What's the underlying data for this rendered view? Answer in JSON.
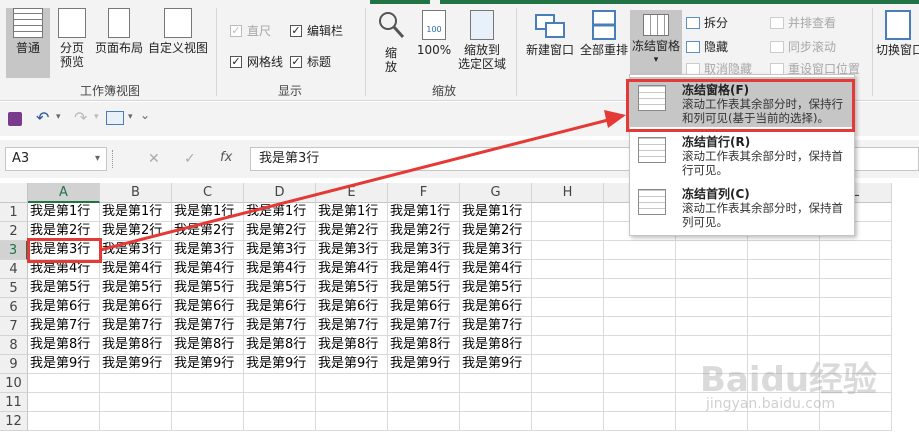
{
  "ribbon": {
    "workbook_views": {
      "normal": "普通",
      "page_break_line1": "分页",
      "page_break_line2": "预览",
      "page_layout": "页面布局",
      "custom_view": "自定义视图",
      "group_label": "工作簿视图"
    },
    "show": {
      "ruler": "直尺",
      "formula_bar": "编辑栏",
      "gridlines": "网格线",
      "headings": "标题",
      "group_label": "显示"
    },
    "zoom": {
      "zoom_line1": "缩",
      "zoom_line2": "放",
      "hundred": "100%",
      "icon_value": "100",
      "zoom_selection_line1": "缩放到",
      "zoom_selection_line2": "选定区域",
      "group_label": "缩放"
    },
    "window": {
      "new_window": "新建窗口",
      "arrange_all": "全部重排",
      "freeze_panes": "冻结窗格",
      "split": "拆分",
      "hide": "隐藏",
      "unhide": "取消隐藏",
      "view_side_by_side": "并排查看",
      "sync_scroll": "同步滚动",
      "reset_position": "重设窗口位置",
      "switch_windows": "切换窗口"
    }
  },
  "formula_bar": {
    "name_box": "A3",
    "fx": "fx",
    "content": "我是第3行",
    "cancel": "✕",
    "confirm": "✓"
  },
  "columns": [
    "A",
    "B",
    "C",
    "D",
    "E",
    "F",
    "G",
    "H",
    "I",
    "J",
    "K",
    "L"
  ],
  "rows": [
    "1",
    "2",
    "3",
    "4",
    "5",
    "6",
    "7",
    "8",
    "9",
    "10",
    "11",
    "12"
  ],
  "cells": [
    "我是第1行",
    "我是第2行",
    "我是第3行",
    "我是第4行",
    "我是第5行",
    "我是第6行",
    "我是第7行",
    "我是第8行",
    "我是第9行"
  ],
  "freeze_menu": {
    "items": [
      {
        "title": "冻结窗格(F)",
        "desc": "滚动工作表其余部分时，保持行和列可见(基于当前的选择)。"
      },
      {
        "title": "冻结首行(R)",
        "desc": "滚动工作表其余部分时，保持首行可见。"
      },
      {
        "title": "冻结首列(C)",
        "desc": "滚动工作表其余部分时，保持首列可见。"
      }
    ]
  },
  "watermark": {
    "line1": "Baidu经验",
    "line2": "jingyan.baidu.com"
  },
  "colors": {
    "excel_green": "#217346",
    "highlight_red": "#e53935",
    "arrow_red": "#e53935"
  }
}
